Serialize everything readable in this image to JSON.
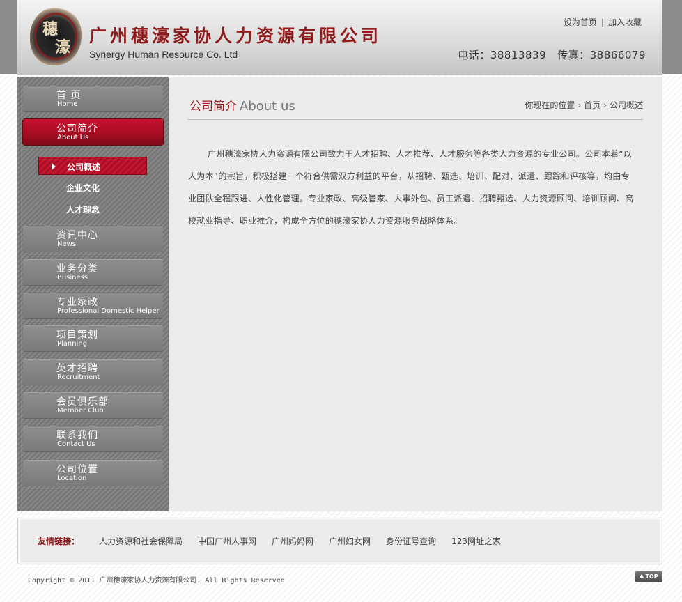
{
  "header": {
    "company_cn": "广州穗濠家协人力资源有限公司",
    "company_en": "Synergy Human Resource Co. Ltd",
    "logo_chars": [
      "穗",
      "濠"
    ],
    "set_homepage": "设为首页",
    "separator": "|",
    "add_favorite": "加入收藏",
    "phone": "电话：38813839",
    "fax": "传真：38866079"
  },
  "sidebar": {
    "items": [
      {
        "cn": "首 页",
        "en": "Home"
      },
      {
        "cn": "公司简介",
        "en": "About Us"
      },
      {
        "cn": "资讯中心",
        "en": "News"
      },
      {
        "cn": "业务分类",
        "en": "Business"
      },
      {
        "cn": "专业家政",
        "en": "Professional Domestic Helper"
      },
      {
        "cn": "项目策划",
        "en": "Planning"
      },
      {
        "cn": "英才招聘",
        "en": "Recruitment"
      },
      {
        "cn": "会员俱乐部",
        "en": "Member Club"
      },
      {
        "cn": "联系我们",
        "en": "Contact Us"
      },
      {
        "cn": "公司位置",
        "en": "Location"
      }
    ],
    "subitems": [
      "公司概述",
      "企业文化",
      "人才理念"
    ]
  },
  "main": {
    "title_cn": "公司简介",
    "title_en": "About us",
    "breadcrumb": {
      "prefix": "你现在的位置",
      "home": "首页",
      "current": "公司概述",
      "chevron": "›"
    },
    "article": "广州穗濠家协人力资源有限公司致力于人才招聘、人才推荐、人才服务等各类人力资源的专业公司。公司本着“以人为本”的宗旨，积极搭建一个符合供需双方利益的平台，从招聘、甄选、培训、配对、派遣、跟踪和评核等，均由专业团队全程跟进、人性化管理。专业家政、高级管家、人事外包、员工派遣、招聘甄选、人力资源顾问、培训顾问、高校就业指导、职业推介，构成全方位的穗濠家协人力资源服务战略体系。"
  },
  "footer": {
    "links_title": "友情链接：",
    "links": [
      "人力资源和社会保障局",
      "中国广州人事网",
      "广州妈妈网",
      "广州妇女网",
      "身份证号查询",
      "123网址之家"
    ],
    "copyright": "Copyright © 2011 广州穗濠家协人力资源有限公司. All Rights Reserved",
    "top_label": "TOP"
  },
  "colors": {
    "accent": "#9a1c1c",
    "active_nav": "#c8102e",
    "sidebar_bg": "#7d7d7d",
    "content_bg": "#ececec"
  }
}
